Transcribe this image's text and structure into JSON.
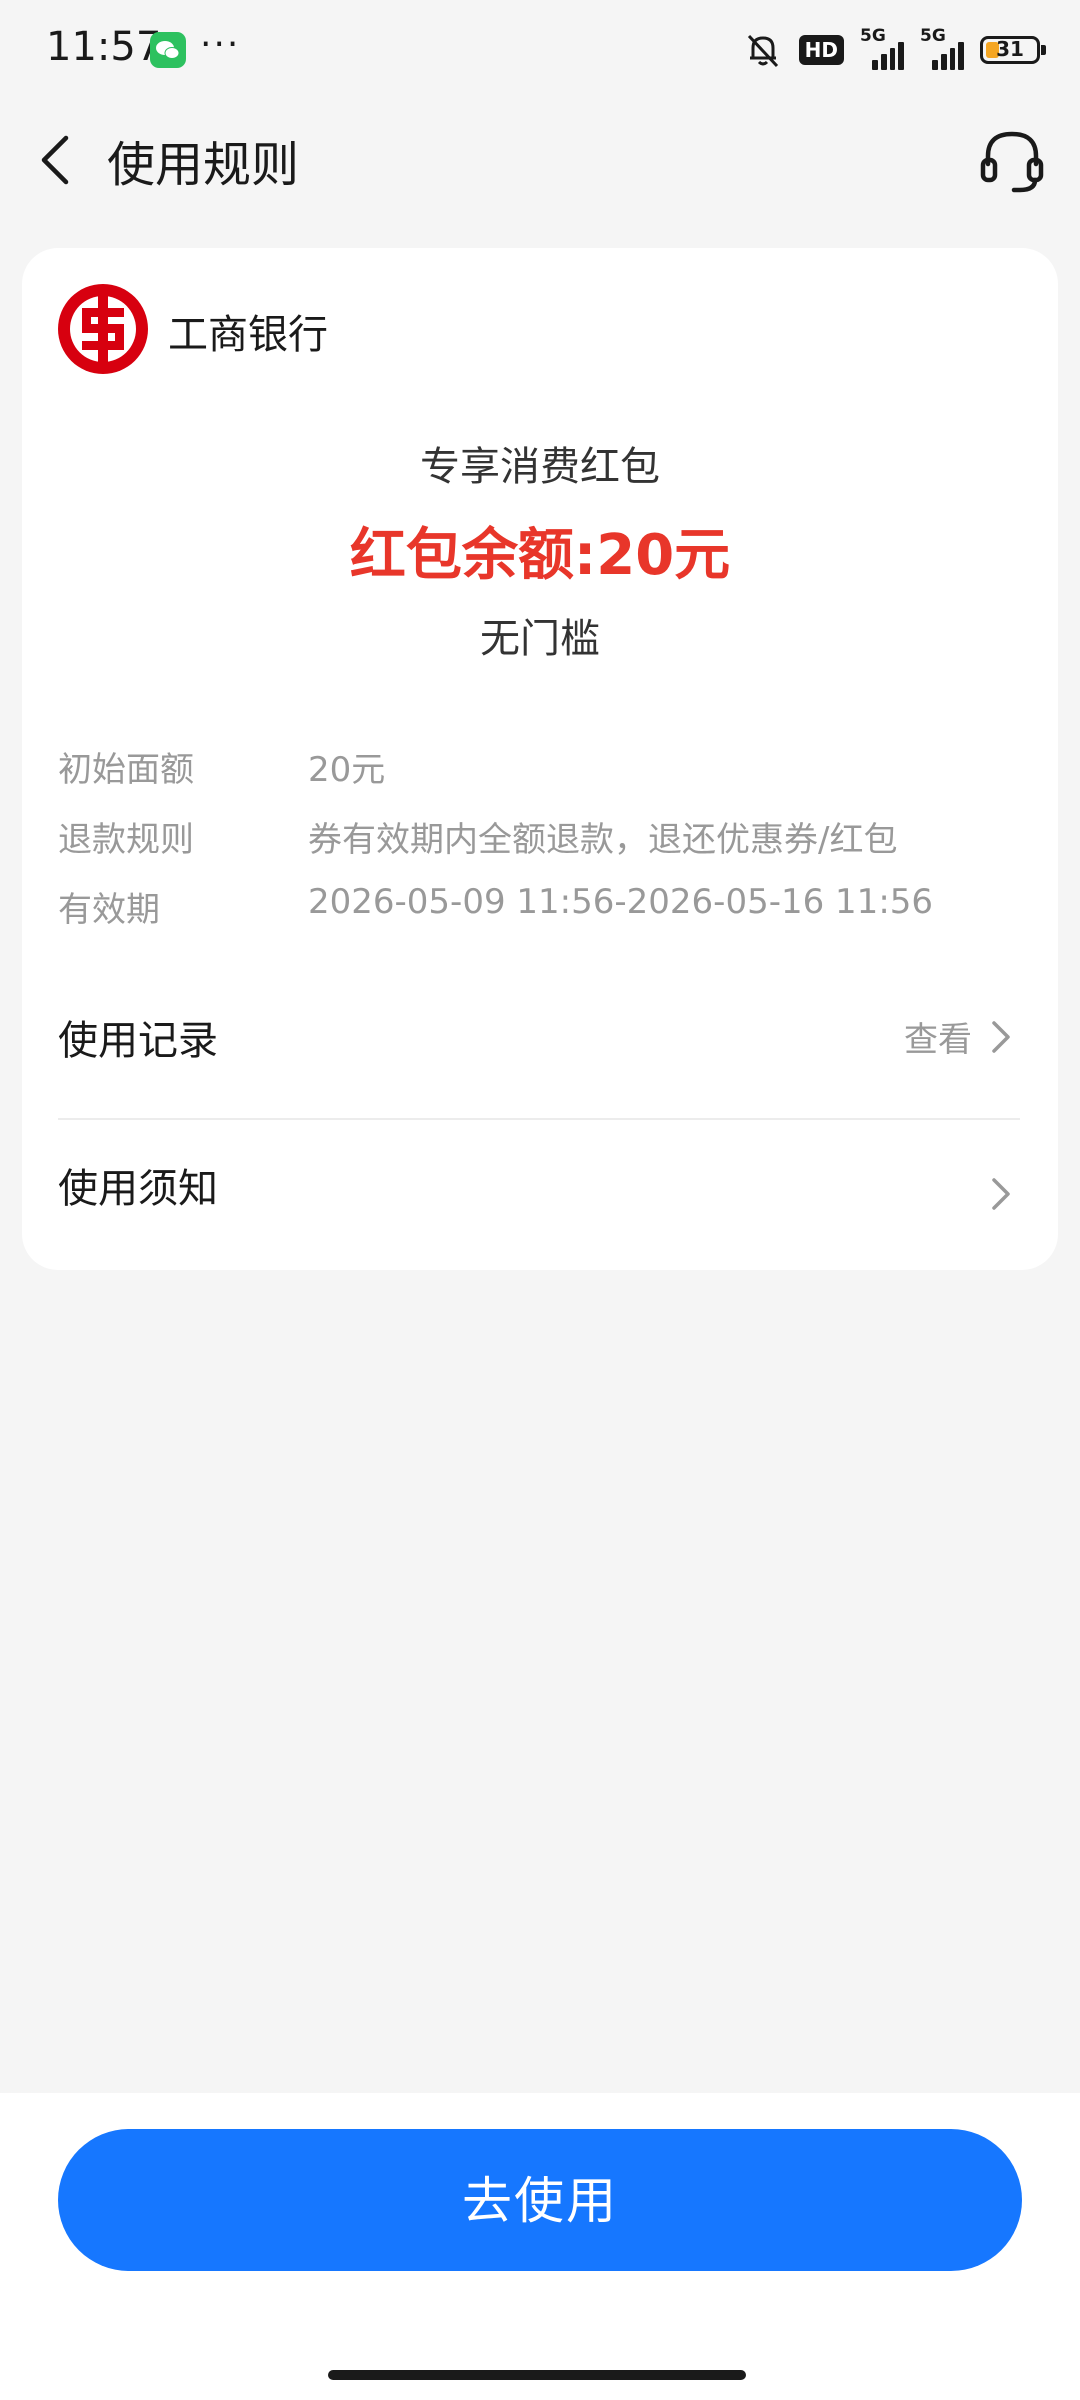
{
  "status_bar": {
    "time": "11:57",
    "more": "···",
    "hd_label": "HD",
    "sim1_label": "5G",
    "sim2_label": "5G",
    "battery": "31"
  },
  "header": {
    "title": "使用规则",
    "back_icon": "chevron-left-icon",
    "service_icon": "headset-icon"
  },
  "card": {
    "bank_name": "工商银行",
    "bank_logo_color": "#d7000f",
    "coupon_type": "专享消费红包",
    "balance": "红包余额:20元",
    "balance_color": "#e8362a",
    "threshold": "无门槛",
    "details": [
      {
        "label": "初始面额",
        "value": "20元"
      },
      {
        "label": "退款规则",
        "value": "券有效期内全额退款，退还优惠券/红包"
      },
      {
        "label": "有效期",
        "value": "2026-05-09 11:56-2026-05-16 11:56"
      }
    ],
    "records": {
      "label": "使用记录",
      "action": "查看"
    },
    "notice": {
      "label": "使用须知"
    }
  },
  "bottom": {
    "use_button": "去使用",
    "button_color": "#1677ff"
  }
}
